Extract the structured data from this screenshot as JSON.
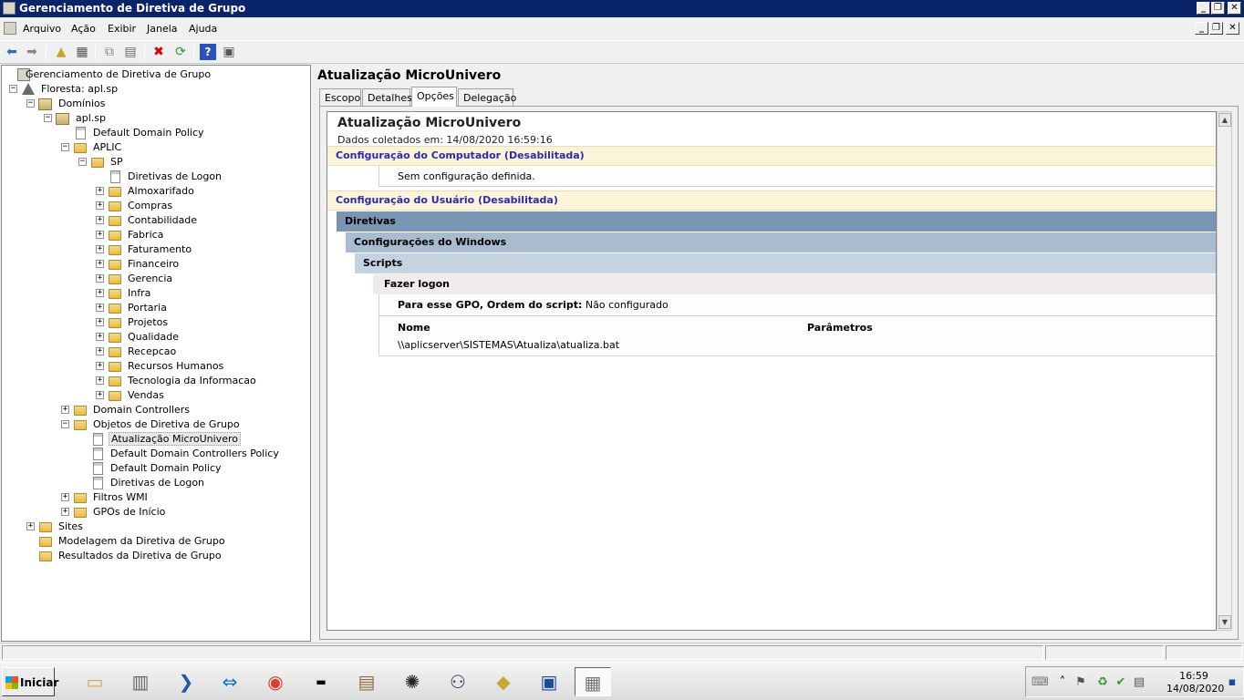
{
  "window": {
    "title": "Gerenciamento de Diretiva de Grupo",
    "controls": {
      "minimize": "_",
      "restore": "❐",
      "close": "✕"
    }
  },
  "menu": {
    "items": [
      "Arquivo",
      "Ação",
      "Exibir",
      "Janela",
      "Ajuda"
    ]
  },
  "toolbar": {
    "icons": [
      "back-arrow-icon",
      "forward-arrow-icon",
      "up-folder-icon",
      "show-hide-tree-icon",
      "copy-icon",
      "paste-icon",
      "delete-icon",
      "refresh-icon",
      "help-icon",
      "properties-icon"
    ]
  },
  "tree": {
    "root": "Gerenciamento de Diretiva de Grupo",
    "forest": "Floresta: apl.sp",
    "domains": "Domínios",
    "domain": "apl.sp",
    "default_domain_policy": "Default Domain Policy",
    "aplic": "APLIC",
    "sp": "SP",
    "sp_gpo": "Diretivas de Logon",
    "sp_children": [
      "Almoxarifado",
      "Compras",
      "Contabilidade",
      "Fabrica",
      "Faturamento",
      "Financeiro",
      "Gerencia",
      "Infra",
      "Portaria",
      "Projetos",
      "Qualidade",
      "Recepcao",
      "Recursos Humanos",
      "Tecnologia da Informacao",
      "Vendas"
    ],
    "domain_controllers": "Domain Controllers",
    "gpo_container": "Objetos de Diretiva de Grupo",
    "gpos": [
      "Atualização MicroUnivero",
      "Default Domain Controllers Policy",
      "Default Domain Policy",
      "Diretivas de Logon"
    ],
    "wmi_filters": "Filtros WMI",
    "starter_gpos": "GPOs de Início",
    "sites": "Sites",
    "modeling": "Modelagem da Diretiva de Grupo",
    "results": "Resultados da Diretiva de Grupo"
  },
  "details": {
    "title": "Atualização MicroUnivero",
    "tabs": [
      "Escopo",
      "Detalhes",
      "Opções",
      "Delegação"
    ],
    "active_tab": "Opções",
    "report": {
      "title": "Atualização MicroUnivero",
      "collected": "Dados coletados em: 14/08/2020 16:59:16",
      "computer_config": "Configuração do Computador (Desabilitada)",
      "computer_none": "Sem configuração definida.",
      "user_config": "Configuração do Usuário (Desabilitada)",
      "policies": "Diretivas",
      "windows_settings": "Configurações do Windows",
      "scripts": "Scripts",
      "logon": "Fazer logon",
      "order_label": "Para esse GPO, Ordem do script:",
      "order_value": "Não configurado",
      "col_name": "Nome",
      "col_params": "Parâmetros",
      "script_path": "\\\\aplicserver\\SISTEMAS\\Atualiza\\atualiza.bat"
    }
  },
  "taskbar": {
    "start": "Iniciar",
    "clock_time": "16:59",
    "clock_date": "14/08/2020"
  }
}
